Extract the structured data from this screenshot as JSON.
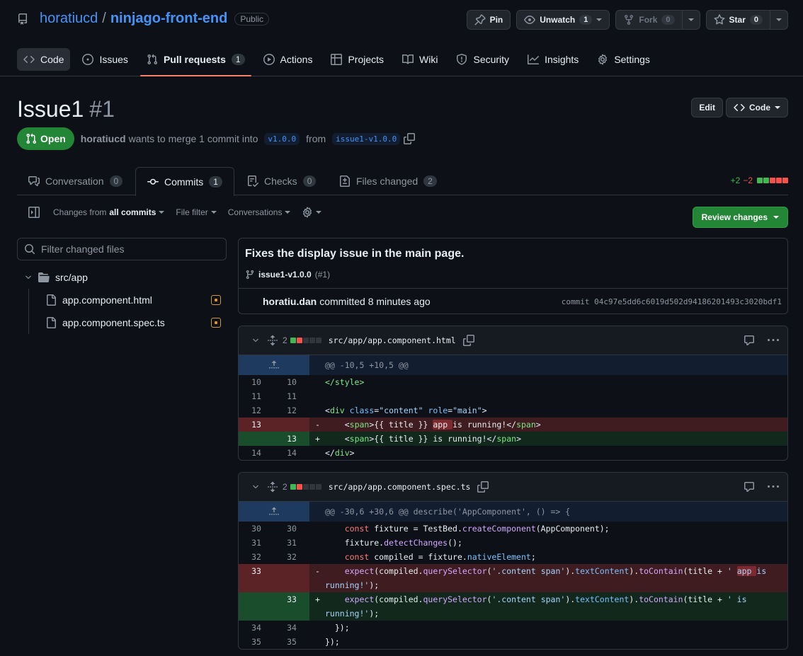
{
  "repo": {
    "owner": "horatiucd",
    "name": "ninjago-front-end",
    "visibility": "Public"
  },
  "repo_actions": {
    "pin": "Pin",
    "unwatch": "Unwatch",
    "watch_count": "1",
    "fork": "Fork",
    "fork_count": "0",
    "star": "Star",
    "star_count": "0"
  },
  "nav": {
    "code": "Code",
    "issues": "Issues",
    "pull_requests": "Pull requests",
    "pr_count": "1",
    "actions": "Actions",
    "projects": "Projects",
    "wiki": "Wiki",
    "security": "Security",
    "insights": "Insights",
    "settings": "Settings"
  },
  "pr": {
    "title": "Issue1",
    "number": "#1",
    "edit": "Edit",
    "code": "Code",
    "state": "Open",
    "author": "horatiucd",
    "merge_text": "wants to merge 1 commit into",
    "base": "v1.0.0",
    "from_text": "from",
    "head": "issue1-v1.0.0"
  },
  "tabs": {
    "conversation": "Conversation",
    "conversation_count": "0",
    "commits": "Commits",
    "commits_count": "1",
    "checks": "Checks",
    "checks_count": "0",
    "files": "Files changed",
    "files_count": "2"
  },
  "diffstat": {
    "additions": "+2",
    "deletions": "−2"
  },
  "toolbar": {
    "changes_from": "Changes from",
    "all_commits": "all commits",
    "file_filter": "File filter",
    "conversations": "Conversations",
    "review": "Review changes"
  },
  "filter": {
    "placeholder": "Filter changed files"
  },
  "tree": {
    "folder": "src/app",
    "files": [
      "app.component.html",
      "app.component.spec.ts"
    ]
  },
  "commit": {
    "message": "Fixes the display issue in the main page.",
    "branch": "issue1-v1.0.0",
    "pr_ref": "(#1)",
    "author": "horatiu.dan",
    "when": "committed 8 minutes ago",
    "sha": "commit 04c97e5dd6c6019d502d94186201493c3020bdf1"
  },
  "file1": {
    "changes": "2",
    "path": "src/app/app.component.html",
    "hunk": "@@ -10,5 +10,5 @@",
    "lines": [
      {
        "old": "10",
        "new": "10",
        "code": "</style>"
      },
      {
        "old": "11",
        "new": "11",
        "code": ""
      },
      {
        "old": "12",
        "new": "12",
        "code": "<div class=\"content\" role=\"main\">"
      },
      {
        "old": "13",
        "new": "",
        "code": "    <span>{{ title }} app is running!</span>"
      },
      {
        "old": "",
        "new": "13",
        "code": "    <span>{{ title }} is running!</span>"
      },
      {
        "old": "14",
        "new": "14",
        "code": "</div>"
      }
    ]
  },
  "file2": {
    "changes": "2",
    "path": "src/app/app.component.spec.ts",
    "hunk": "@@ -30,6 +30,6 @@ describe('AppComponent', () => {",
    "lines": [
      {
        "old": "30",
        "new": "30",
        "code": "    const fixture = TestBed.createComponent(AppComponent);"
      },
      {
        "old": "31",
        "new": "31",
        "code": "    fixture.detectChanges();"
      },
      {
        "old": "32",
        "new": "32",
        "code": "    const compiled = fixture.nativeElement;"
      },
      {
        "old": "33",
        "new": "",
        "code": "    expect(compiled.querySelector('.content span').textContent).toContain(title + ' app is running!');"
      },
      {
        "old": "",
        "new": "33",
        "code": "    expect(compiled.querySelector('.content span').textContent).toContain(title + ' is running!');"
      },
      {
        "old": "34",
        "new": "34",
        "code": "  });"
      },
      {
        "old": "35",
        "new": "35",
        "code": "});"
      }
    ]
  },
  "colors": {
    "accent": "#4493f8",
    "open": "#238636",
    "add": "#3fb950",
    "del": "#f85149",
    "modified": "#d29922",
    "active_tab": "#f78166"
  }
}
